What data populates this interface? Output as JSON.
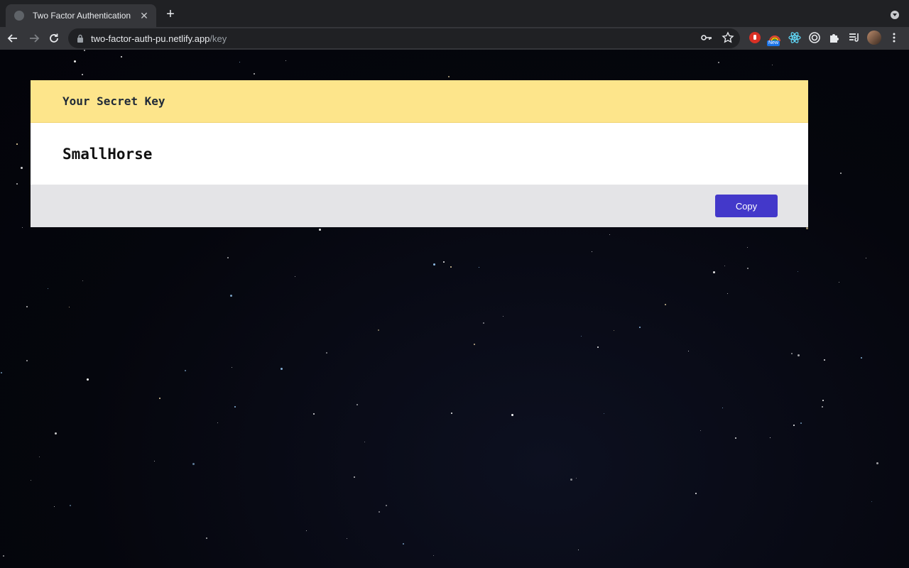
{
  "browser": {
    "tab": {
      "title": "Two Factor Authentication",
      "close_glyph": "✕"
    },
    "new_tab_glyph": "+",
    "address": {
      "host": "two-factor-auth-pu.netlify.app",
      "path": "/key"
    },
    "extensions": [
      {
        "name": "adblock-icon",
        "color": "#d93025"
      },
      {
        "name": "rainbow-extension-icon",
        "badge": "New"
      },
      {
        "name": "react-devtools-icon",
        "color": "#61dafb"
      },
      {
        "name": "target-extension-icon",
        "color": "#e8eaed"
      },
      {
        "name": "puzzle-extensions-icon",
        "color": "#e8eaed"
      },
      {
        "name": "reading-list-icon",
        "color": "#e8eaed"
      }
    ]
  },
  "page": {
    "header_title": "Your Secret Key",
    "secret_key": "SmallHorse",
    "copy_label": "Copy",
    "colors": {
      "header_bg": "#fde58b",
      "body_bg": "#ffffff",
      "footer_bg": "#e4e4e7",
      "button_bg": "#4338ca"
    }
  }
}
